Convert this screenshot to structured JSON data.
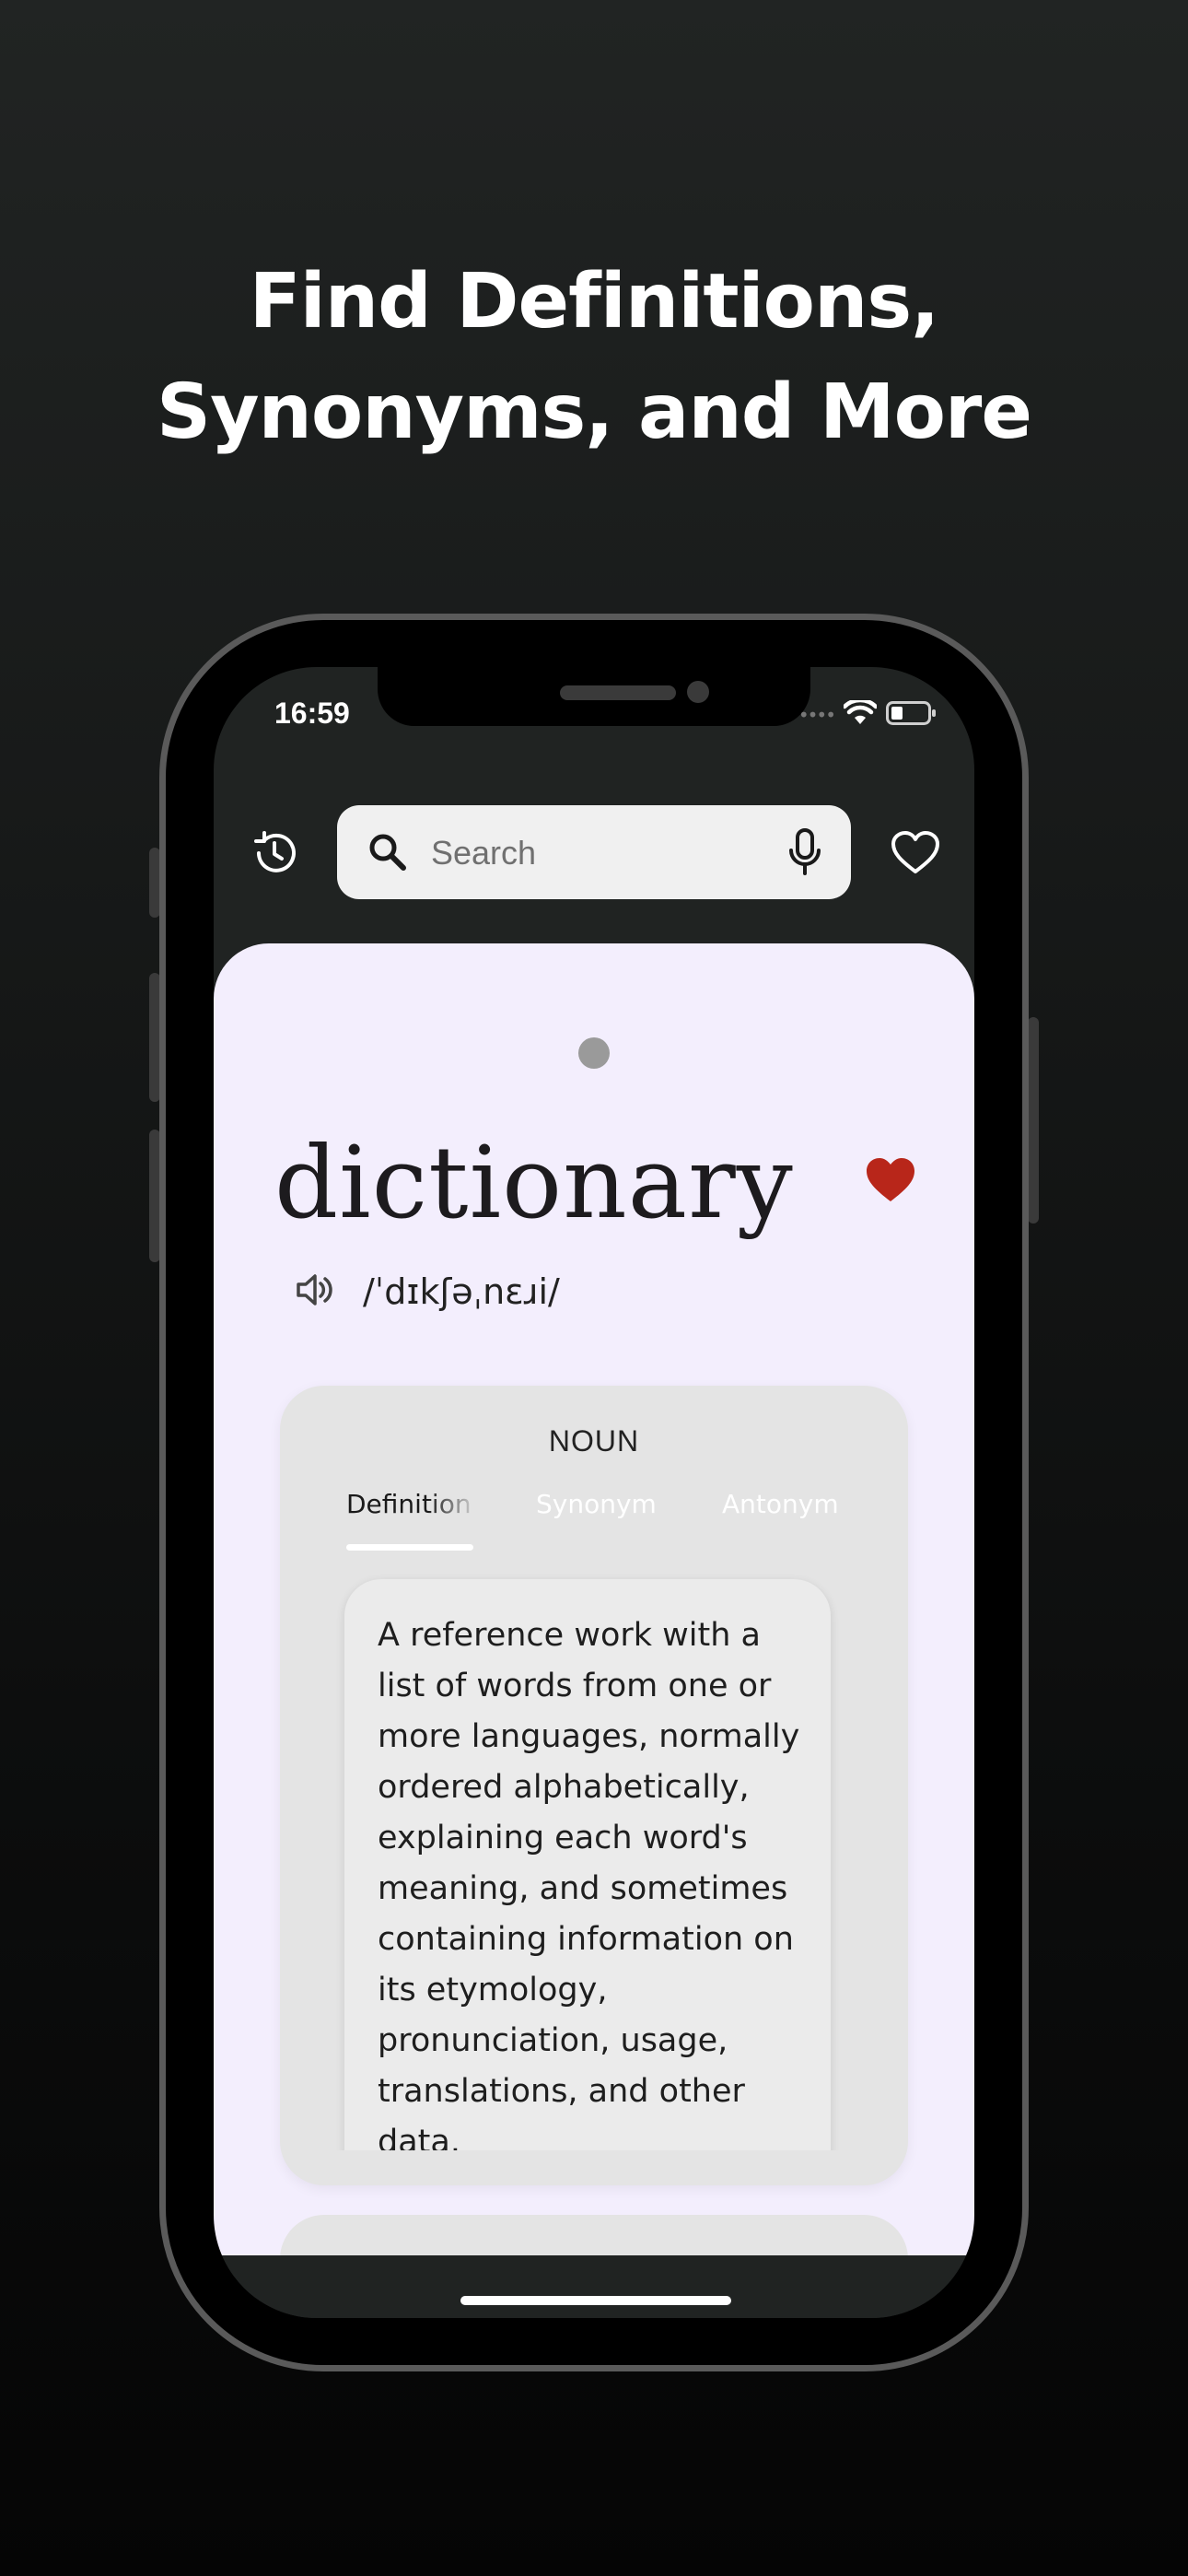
{
  "headline": {
    "line1": "Find Definitions,",
    "line2": "Synonyms, and More"
  },
  "status_bar": {
    "time": "16:59",
    "icons": [
      "signal-dots-icon",
      "wifi-icon",
      "battery-icon"
    ]
  },
  "toolbar": {
    "history_icon": "history-icon",
    "search_placeholder": "Search",
    "search_icon": "search-icon",
    "mic_icon": "microphone-icon",
    "favorites_icon": "heart-outline-icon"
  },
  "entry": {
    "word": "dictionary",
    "phonetic": "/ˈdɪkʃəˌnɛɹi/",
    "favorited": true,
    "favorite_color": "#b8261a"
  },
  "card": {
    "part_of_speech": "NOUN",
    "tabs": [
      {
        "label": "Definition",
        "active": true
      },
      {
        "label": "Synonym",
        "active": false
      },
      {
        "label": "Antonym",
        "active": false
      }
    ],
    "definition": "A reference work with a list of words from one or more languages, normally ordered alphabetically, explaining each word's meaning, and sometimes containing information on its etymology, pronunciation, usage, translations, and other data."
  },
  "colors": {
    "background_dark": "#1c1e1d",
    "sheet": "#f3eefd",
    "card": "#e4e4e4"
  }
}
